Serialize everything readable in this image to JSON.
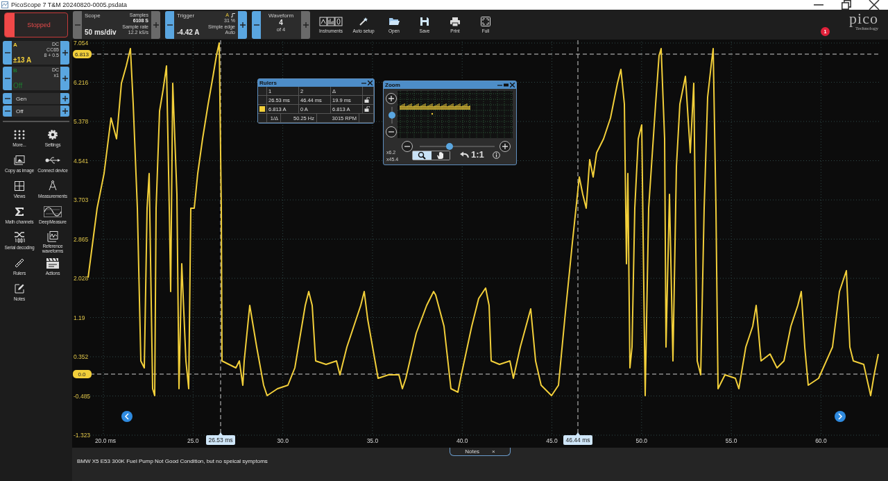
{
  "window": {
    "title": "PicoScope 7 T&M 20240820-0005.psdata"
  },
  "toolbar": {
    "run_button": {
      "label": "Stopped"
    },
    "scope": {
      "title": "Scope",
      "value": "50 ms/div",
      "samples_label": "Samples",
      "samples": "6108 S",
      "rate_label": "Sample rate",
      "rate": "12.2 kS/s",
      "minus_enabled": false,
      "plus_enabled": false
    },
    "trigger": {
      "title": "Trigger",
      "value": "-4.42 A",
      "source": "A",
      "level": "31 %",
      "mode": "Simple edge",
      "type": "Auto",
      "minus_enabled": true,
      "plus_enabled": true
    },
    "waveform": {
      "title": "Waveform",
      "value": "4",
      "of": "of 4",
      "minus_enabled": true,
      "plus_enabled": false
    },
    "buttons": [
      {
        "label": "Instruments",
        "kind": "instruments"
      },
      {
        "label": "Auto setup",
        "kind": "wand"
      },
      {
        "label": "Open",
        "kind": "folder"
      },
      {
        "label": "Save",
        "kind": "save"
      },
      {
        "label": "Print",
        "kind": "print"
      },
      {
        "label": "Full",
        "kind": "full"
      }
    ],
    "logo": {
      "text": "pico",
      "subtitle": "Technology"
    },
    "badge": "1"
  },
  "channels": [
    {
      "name": "A",
      "range": "±13 A",
      "coupling": "DC",
      "probe": "CC65",
      "setting": "8 + 0.5",
      "color": "#f2cf3a",
      "enabled": true
    },
    {
      "name": "B",
      "range": "Off",
      "coupling": "DC",
      "probe": "x1",
      "color": "#1e7a30",
      "enabled": false
    }
  ],
  "generator": [
    "Gen",
    "Off"
  ],
  "tools": [
    {
      "label": "More...",
      "kind": "dots"
    },
    {
      "label": "Settings",
      "kind": "gear"
    },
    {
      "label": "Copy as image",
      "kind": "image"
    },
    {
      "label": "Connect device",
      "kind": "usb"
    },
    {
      "label": "Views",
      "kind": "grid"
    },
    {
      "label": "Measurements",
      "kind": "compass"
    },
    {
      "label": "Math channels",
      "kind": "sigma"
    },
    {
      "label": "DeepMeasure",
      "kind": "sine"
    },
    {
      "label": "Serial decoding",
      "kind": "serial"
    },
    {
      "label": "Reference waveforms",
      "kind": "reference"
    },
    {
      "label": "Rulers",
      "kind": "ruler"
    },
    {
      "label": "Actions",
      "kind": "clapper"
    },
    {
      "label": "Notes",
      "kind": "note"
    }
  ],
  "plot": {
    "y_ticks": [
      "7.054",
      "6.216",
      "5.378",
      "4.541",
      "3.703",
      "2.865",
      "2.028",
      "1.19",
      "0.352",
      "-0.485",
      "-1.323"
    ],
    "x_ticks": [
      "20.0 ms",
      "25.0",
      "30.0",
      "35.0",
      "40.0",
      "45.0",
      "50.0",
      "55.0",
      "60.0"
    ],
    "x_rulers": [
      {
        "label": "26.53 ms"
      },
      {
        "label": "46.44 ms"
      }
    ],
    "y_rulers": [
      {
        "label": "6.813"
      },
      {
        "label": "0.0"
      }
    ]
  },
  "rulers_window": {
    "title": "Rulers",
    "header": [
      "1",
      "2",
      "Δ"
    ],
    "rows": [
      {
        "cells": [
          "26.53 ms",
          "46.44 ms",
          "19.9 ms"
        ]
      },
      {
        "color": "#f2cf3a",
        "cells": [
          "6.813 A",
          "0 A",
          "6.813 A"
        ]
      }
    ],
    "footer": [
      "1/Δ",
      "50.25 Hz",
      "3015 RPM"
    ]
  },
  "zoom_window": {
    "title": "Zoom",
    "vertical": {
      "level": 0.5
    },
    "horizontal": {
      "level": 0.4
    },
    "factors": [
      "x6.2",
      "x45.4"
    ],
    "modes": [
      {
        "kind": "zoom",
        "selected": true
      },
      {
        "kind": "pan",
        "selected": false
      }
    ],
    "reset": "1:1"
  },
  "notes": {
    "tab": "Notes",
    "close": "×",
    "text": "BMW X5 E53 300K Fuel Pump Not Good Condition, but no speical symptoms"
  }
}
